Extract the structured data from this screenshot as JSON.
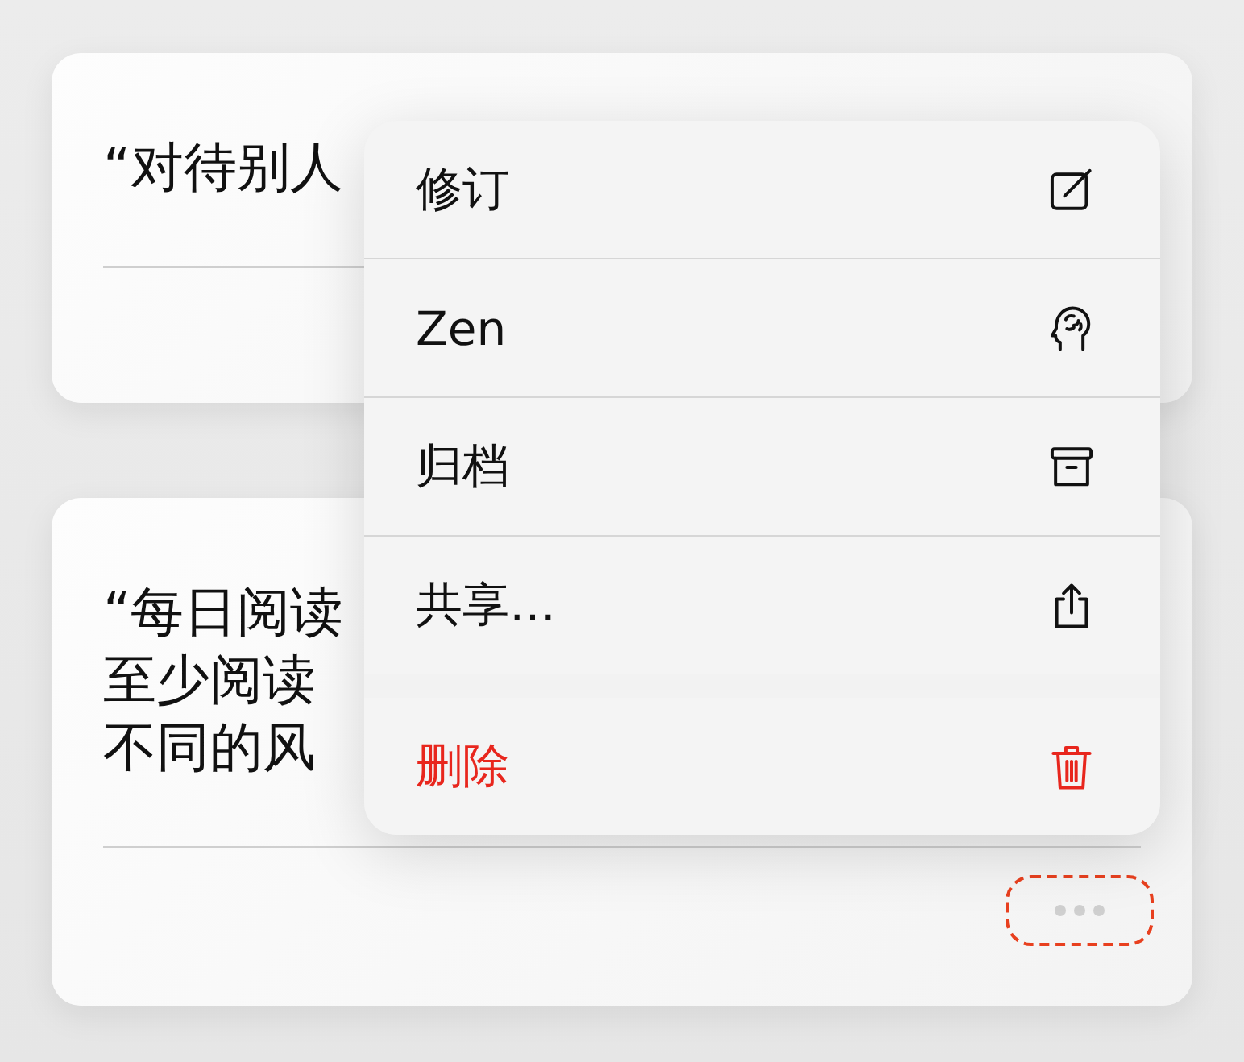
{
  "cards": [
    {
      "kind": "plain",
      "lines": [
        "“对待别人"
      ]
    },
    {
      "kind": "actions",
      "lines": [
        "“每日阅读",
        "至少阅读",
        "不同的风"
      ]
    }
  ],
  "menu": {
    "items": [
      {
        "label": "修订",
        "kind": "edit"
      },
      {
        "label": "Zen",
        "kind": "zen"
      },
      {
        "label": "归档",
        "kind": "archive"
      },
      {
        "label": "共享…",
        "kind": "share"
      },
      {
        "label": "删除",
        "kind": "delete"
      }
    ]
  }
}
